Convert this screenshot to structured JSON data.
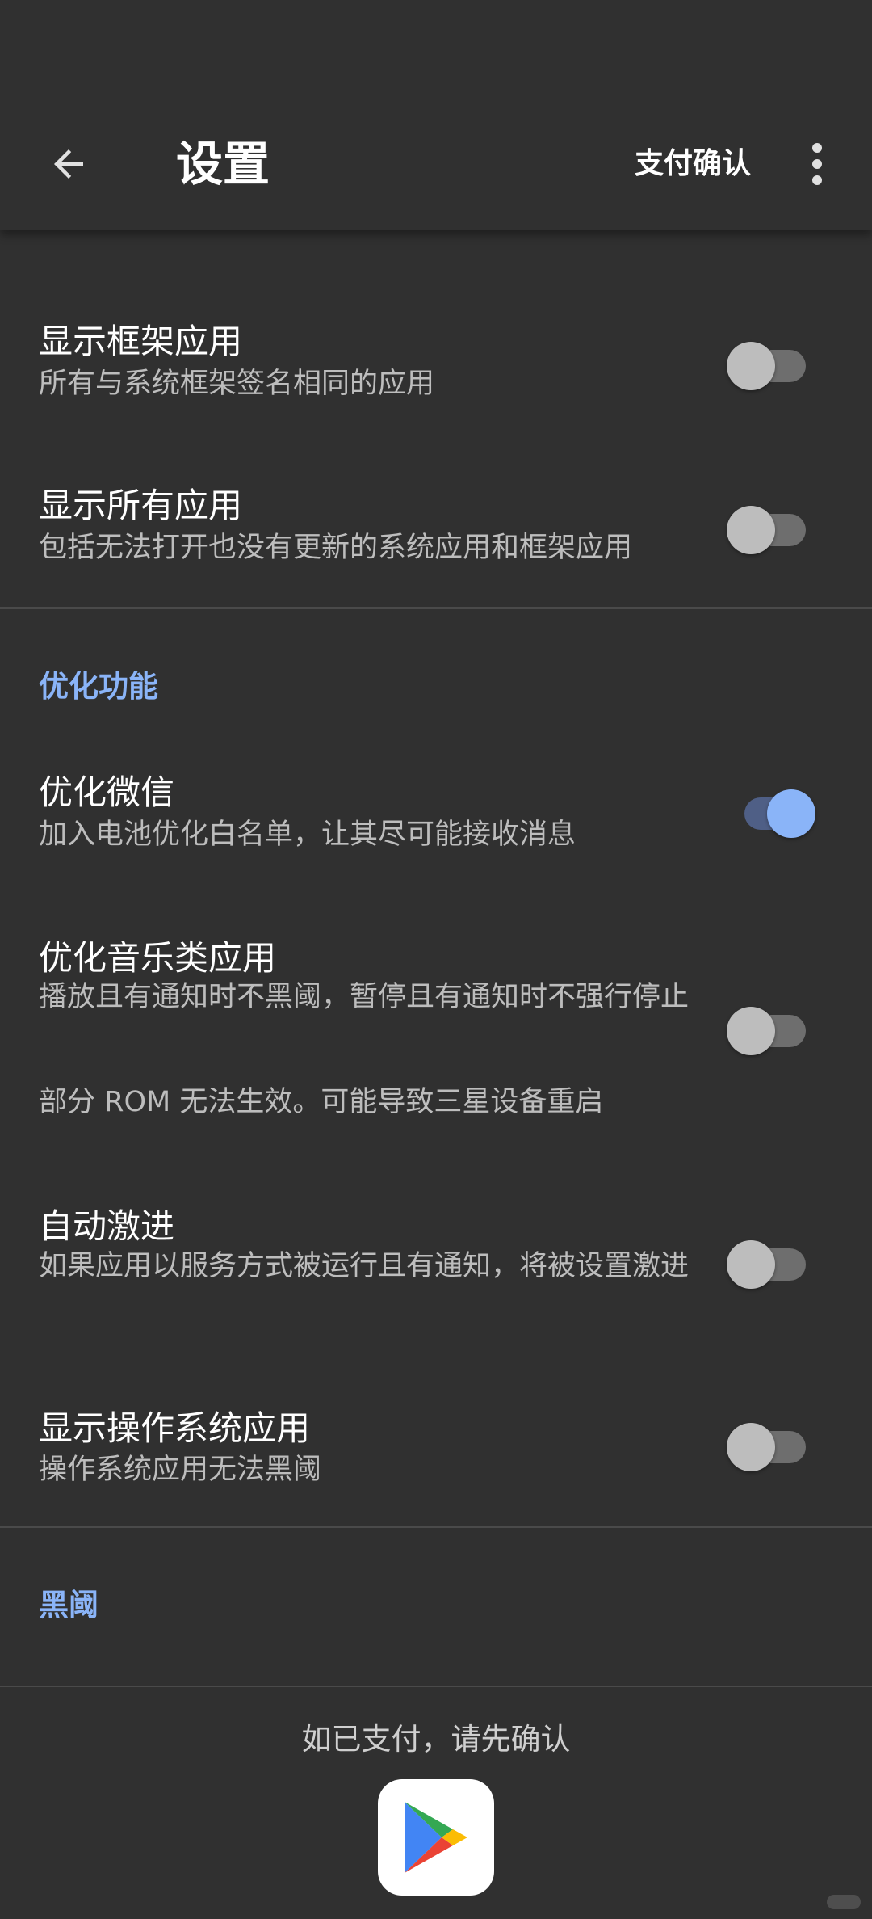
{
  "appbar": {
    "title": "设置",
    "pay_confirm": "支付确认",
    "back_icon": "arrow-back-icon",
    "more_icon": "more-vert-icon"
  },
  "clipped_header": "",
  "rows": [
    {
      "title": "显示框架应用",
      "summary": "所有与系统框架签名相同的应用",
      "checked": false
    },
    {
      "title": "显示所有应用",
      "summary": "包括无法打开也没有更新的系统应用和框架应用",
      "checked": false
    }
  ],
  "section_optimize": {
    "header": "优化功能",
    "rows": [
      {
        "title": "优化微信",
        "summary": "加入电池优化白名单，让其尽可能接收消息",
        "checked": true
      },
      {
        "title": "优化音乐类应用",
        "summary": "播放且有通知时不黑阈，暂停且有通知时不强行停止",
        "extra": "部分 ROM 无法生效。可能导致三星设备重启",
        "checked": false
      },
      {
        "title": "自动激进",
        "summary": "如果应用以服务方式被运行且有通知，将被设置激进",
        "checked": false
      },
      {
        "title": "显示操作系统应用",
        "summary": "操作系统应用无法黑阈",
        "checked": false
      }
    ]
  },
  "section_blackgate": {
    "header": "黑阈"
  },
  "bottom": {
    "message": "如已支付，请先确认",
    "play_icon": "google-play-icon"
  },
  "colors": {
    "background": "#303030",
    "accent": "#8ab4f8",
    "switch_on_track": "#4f5f86",
    "switch_off_thumb": "#bdbdbd"
  }
}
